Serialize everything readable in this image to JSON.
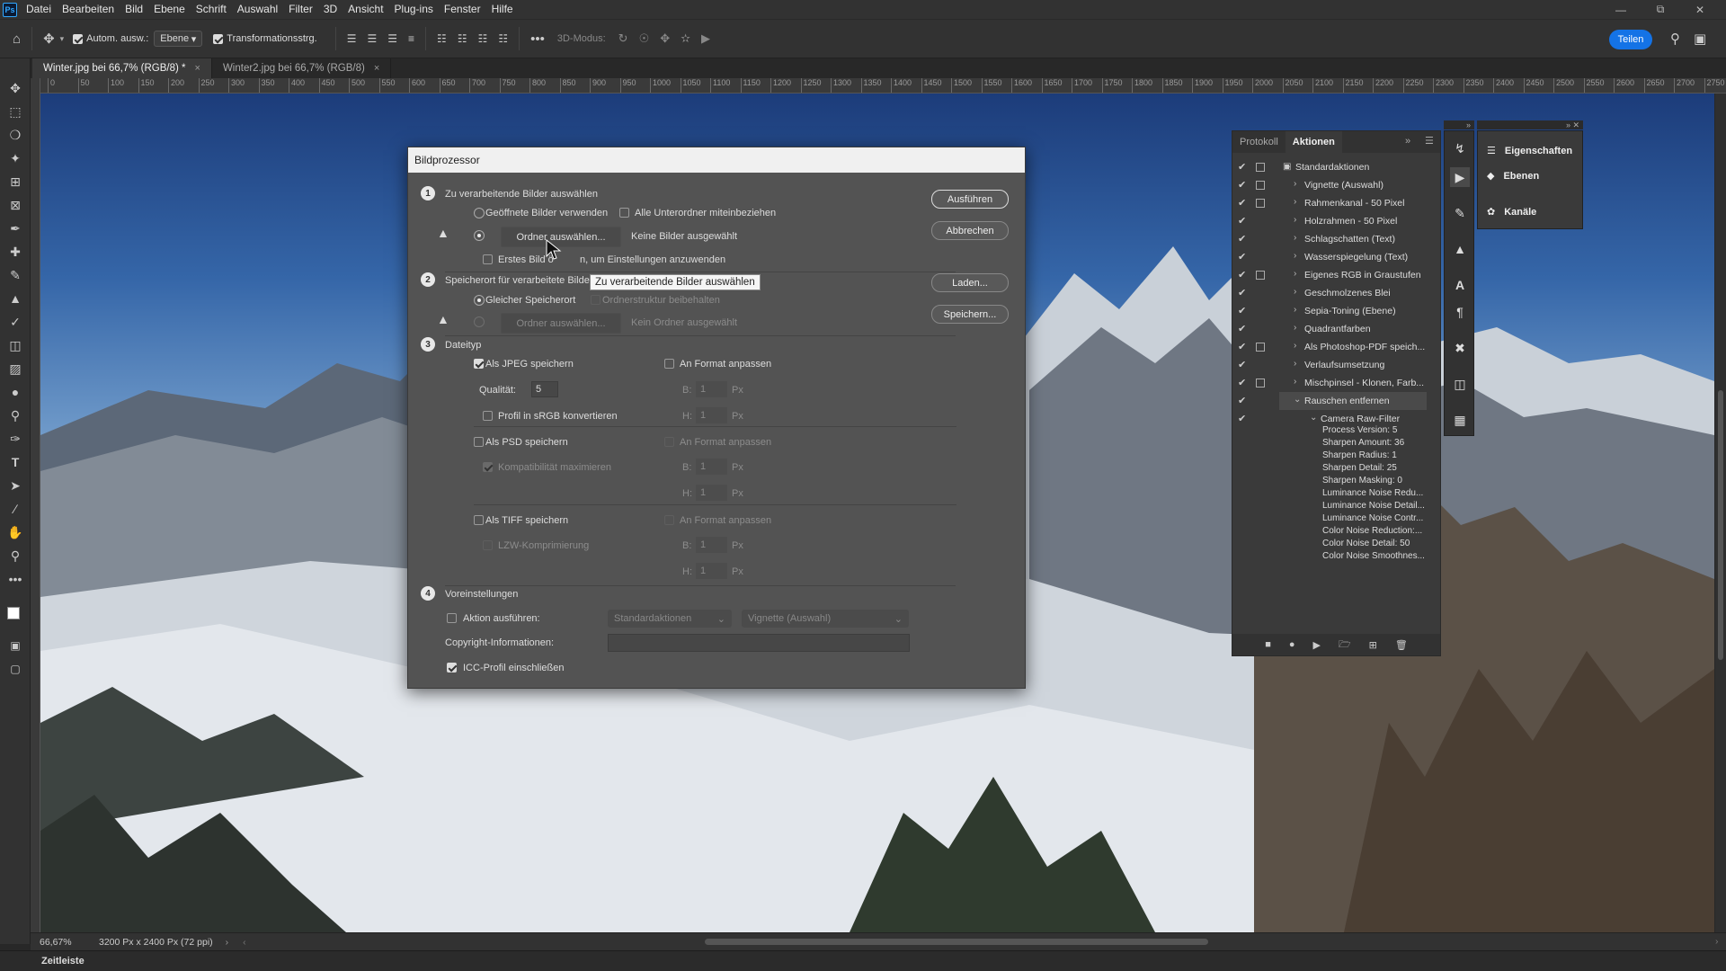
{
  "menubar": {
    "logo": "Ps",
    "items": [
      "Datei",
      "Bearbeiten",
      "Bild",
      "Ebene",
      "Schrift",
      "Auswahl",
      "Filter",
      "3D",
      "Ansicht",
      "Plug-ins",
      "Fenster",
      "Hilfe"
    ]
  },
  "optbar": {
    "auto_select_label": "Autom. ausw.:",
    "auto_select_value": "Ebene",
    "transform_label": "Transformationsstrg.",
    "mode3d_label": "3D-Modus:",
    "share_label": "Teilen"
  },
  "tabs": [
    {
      "label": "Winter.jpg bei 66,7% (RGB/8) *",
      "close": "×"
    },
    {
      "label": "Winter2.jpg bei 66,7% (RGB/8)",
      "close": "×"
    }
  ],
  "ruler": [
    "0",
    "50",
    "100",
    "150",
    "200",
    "250",
    "300",
    "350",
    "400",
    "450",
    "500",
    "550",
    "600",
    "650",
    "700",
    "750",
    "800",
    "850",
    "900",
    "950",
    "1000",
    "1050",
    "1100",
    "1150",
    "1200",
    "1250",
    "1300",
    "1350",
    "1400",
    "1450",
    "1500",
    "1550",
    "1600",
    "1650",
    "1700",
    "1750",
    "1800",
    "1850",
    "1900",
    "1950",
    "2000",
    "2050",
    "2100",
    "2150",
    "2200",
    "2250",
    "2300",
    "2350",
    "2400",
    "2450",
    "2500",
    "2550",
    "2600",
    "2650",
    "2700",
    "2750"
  ],
  "status": {
    "zoom": "66,67%",
    "size": "3200 Px x 2400 Px (72 ppi)"
  },
  "timeline_label": "Zeitleiste",
  "dialog": {
    "title": "Bildprozessor",
    "s1": {
      "num": "1",
      "title": "Zu verarbeitende Bilder auswählen",
      "opt_open": "Geöffnete Bilder verwenden",
      "opt_subfolders": "Alle Unterordner miteinbeziehen",
      "select_folder": "Ordner auswählen...",
      "no_images": "Keine Bilder ausgewählt",
      "first_image_a": "Erstes Bild ö",
      "first_image_b": "n, um Einstellungen anzuwenden"
    },
    "tooltip": "Zu verarbeitende Bilder auswählen",
    "s2": {
      "num": "2",
      "title": "Speicherort für verarbeitete Bilde",
      "same_location": "Gleicher Speicherort",
      "keep_structure": "Ordnerstruktur beibehalten",
      "select_folder": "Ordner auswählen...",
      "no_folder": "Kein Ordner ausgewählt"
    },
    "s3": {
      "num": "3",
      "title": "Dateityp",
      "jpeg": "Als JPEG speichern",
      "fit": "An Format anpassen",
      "quality_label": "Qualität:",
      "quality_value": "5",
      "w_label": "B:",
      "h_label": "H:",
      "dim_value": "1",
      "unit": "Px",
      "srgb": "Profil in sRGB konvertieren",
      "psd": "Als PSD speichern",
      "compat": "Kompatibilität maximieren",
      "tiff": "Als TIFF speichern",
      "lzw": "LZW-Komprimierung"
    },
    "s4": {
      "num": "4",
      "title": "Voreinstellungen",
      "run_action": "Aktion ausführen:",
      "action_set": "Standardaktionen",
      "action": "Vignette (Auswahl)",
      "copyright": "Copyright-Informationen:",
      "icc": "ICC-Profil einschließen"
    },
    "buttons": {
      "run": "Ausführen",
      "cancel": "Abbrechen",
      "load": "Laden...",
      "save": "Speichern..."
    }
  },
  "actions_panel": {
    "tabs": [
      "Protokoll",
      "Aktionen"
    ],
    "set_name": "Standardaktionen",
    "actions": [
      {
        "label": "Vignette (Auswahl)",
        "dialog": true
      },
      {
        "label": "Rahmenkanal - 50 Pixel",
        "dialog": true
      },
      {
        "label": "Holzrahmen - 50 Pixel",
        "dialog": false
      },
      {
        "label": "Schlagschatten (Text)",
        "dialog": false
      },
      {
        "label": "Wasserspiegelung (Text)",
        "dialog": false
      },
      {
        "label": "Eigenes RGB in Graustufen",
        "dialog": true
      },
      {
        "label": "Geschmolzenes Blei",
        "dialog": false
      },
      {
        "label": "Sepia-Toning (Ebene)",
        "dialog": false
      },
      {
        "label": "Quadrantfarben",
        "dialog": false
      },
      {
        "label": "Als Photoshop-PDF speich...",
        "dialog": true
      },
      {
        "label": "Verlaufsumsetzung",
        "dialog": false
      },
      {
        "label": "Mischpinsel - Klonen, Farb...",
        "dialog": true
      },
      {
        "label": "Rauschen entfernen",
        "dialog": false
      }
    ],
    "step": "Camera Raw-Filter",
    "step_details": [
      "Process Version: 5",
      "Sharpen Amount: 36",
      "Sharpen Radius: 1",
      "Sharpen Detail: 25",
      "Sharpen Masking: 0",
      "Luminance Noise Redu...",
      "Luminance Noise Detail...",
      "Luminance Noise Contr...",
      "Color Noise Reduction:...",
      "Color Noise Detail: 50",
      "Color Noise Smoothnes..."
    ]
  },
  "flyout": {
    "items": [
      "Eigenschaften",
      "Ebenen",
      "Kanäle"
    ]
  }
}
